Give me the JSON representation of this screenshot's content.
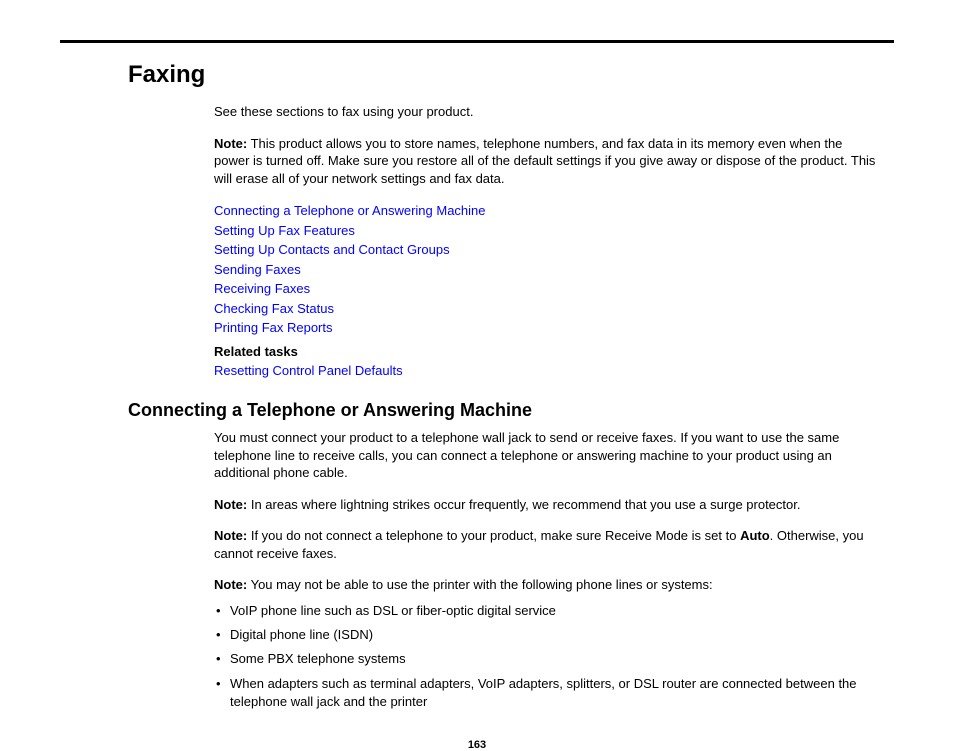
{
  "chapter_title": "Faxing",
  "intro": "See these sections to fax using your product.",
  "note1_label": "Note:",
  "note1_text": " This product allows you to store names, telephone numbers, and fax data in its memory even when the power is turned off. Make sure you restore all of the default settings if you give away or dispose of the product. This will erase all of your network settings and fax data.",
  "links": [
    "Connecting a Telephone or Answering Machine",
    "Setting Up Fax Features",
    "Setting Up Contacts and Contact Groups",
    "Sending Faxes",
    "Receiving Faxes",
    "Checking Fax Status",
    "Printing Fax Reports"
  ],
  "related_tasks_label": "Related tasks",
  "related_link": "Resetting Control Panel Defaults",
  "section_title": "Connecting a Telephone or Answering Machine",
  "section_intro": "You must connect your product to a telephone wall jack to send or receive faxes. If you want to use the same telephone line to receive calls, you can connect a telephone or answering machine to your product using an additional phone cable.",
  "note2_label": "Note:",
  "note2_text": " In areas where lightning strikes occur frequently, we recommend that you use a surge protector.",
  "note3_label": "Note:",
  "note3_text_a": " If you do not connect a telephone to your product, make sure Receive Mode is set to ",
  "note3_bold": "Auto",
  "note3_text_b": ". Otherwise, you cannot receive faxes.",
  "note4_label": "Note:",
  "note4_text": " You may not be able to use the printer with the following phone lines or systems:",
  "bullets": [
    "VoIP phone line such as DSL or fiber-optic digital service",
    "Digital phone line (ISDN)",
    "Some PBX telephone systems",
    "When adapters such as terminal adapters, VoIP adapters, splitters, or DSL router are connected between the telephone wall jack and the printer"
  ],
  "page_number": "163"
}
